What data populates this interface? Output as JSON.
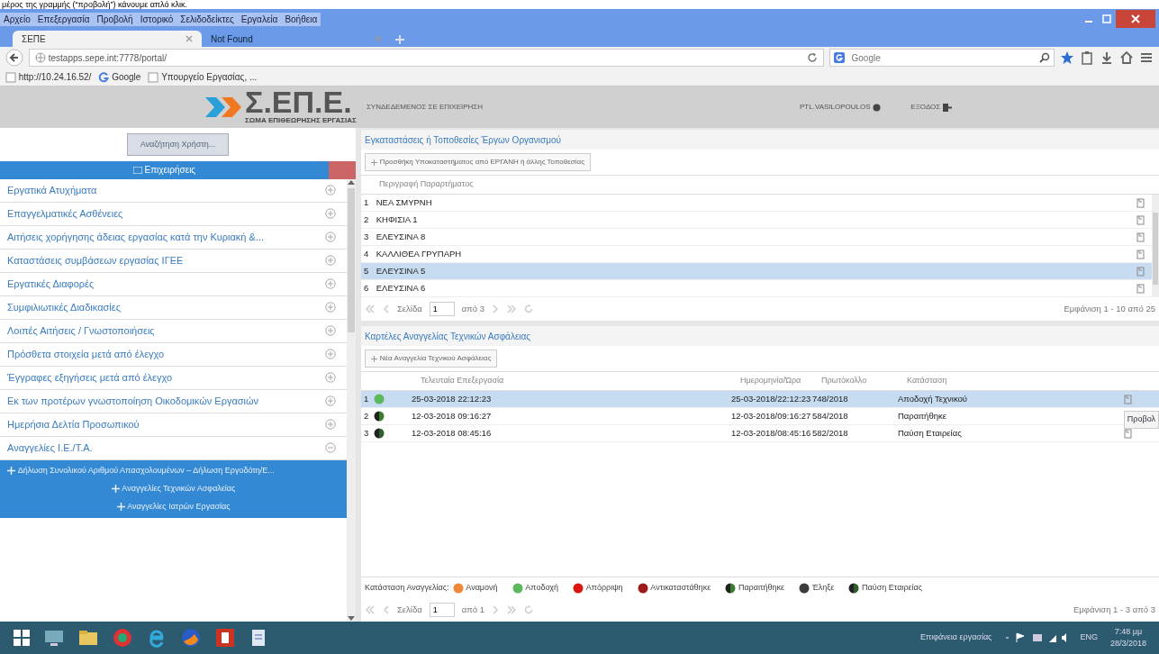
{
  "document_caption": "μέρος της γραμμής (“προβολή”) κάνουμε απλό κλικ.",
  "menu_bar": [
    "Αρχείο",
    "Επεξεργασία",
    "Προβολή",
    "Ιστορικό",
    "Σελιδοδείκτες",
    "Εργαλεία",
    "Βοήθεια"
  ],
  "browser_tabs": [
    {
      "label": "ΣΕΠΕ",
      "selected": true
    },
    {
      "label": "Not Found",
      "selected": false
    }
  ],
  "address_bar": {
    "value": "testapps.sepe.int:7778/portal/"
  },
  "search_bar": {
    "placeholder": "Google"
  },
  "bookmarks": [
    {
      "kind": "page",
      "label": "http://10.24.16.52/"
    },
    {
      "kind": "google",
      "label": "Google"
    },
    {
      "kind": "page",
      "label": "Υπουργείο Εργασίας, ..."
    }
  ],
  "app_header": {
    "logo": "Σ.ΕΠ.Ε.",
    "logo_subtitle": "ΣΩΜΑ ΕΠΙΘΕΩΡΗΣΗΣ ΕΡΓΑΣΙΑΣ",
    "context": "ΣΥΝΔΕΔΕΜΕΝΟΣ ΣΕ ΕΠΙΧΕΙΡΗΣΗ",
    "user": "PTL.VASILOPOULOS",
    "logout": "ΕΞΟΔΟΣ"
  },
  "sidebar": {
    "top_button": "Αναζήτηση Χρήστη...",
    "header": "Επιχειρήσεις",
    "items": [
      {
        "label": "Εργατικά Ατυχήματα",
        "expanded": false
      },
      {
        "label": "Επαγγελματικές Ασθένειες",
        "expanded": false
      },
      {
        "label": "Αιτήσεις χορήγησης άδειας εργασίας κατά την Κυριακή &...",
        "expanded": false
      },
      {
        "label": "Καταστάσεις συμβάσεων εργασίας ΙΓΕΕ",
        "expanded": false
      },
      {
        "label": "Εργατικές Διαφορές",
        "expanded": false
      },
      {
        "label": "Συμφιλιωτικές Διαδικασίες",
        "expanded": false
      },
      {
        "label": "Λοιπές Αιτήσεις / Γνωστοποιήσεις",
        "expanded": false
      },
      {
        "label": "Πρόσθετα στοιχεία μετά από έλεγχο",
        "expanded": false
      },
      {
        "label": "Έγγραφες εξηγήσεις μετά από έλεγχο",
        "expanded": false
      },
      {
        "label": "Εκ των προτέρων γνωστοποίηση Οικοδομικών Εργασιών",
        "expanded": false
      },
      {
        "label": "Ημερήσια Δελτία Προσωπικού",
        "expanded": false
      },
      {
        "label": "Αναγγελίες Ι.Ε./Τ.Α.",
        "expanded": true,
        "children": [
          {
            "label": "Δήλωση Συνολικού Αριθμού Απασχολουμένων – Δήλωση Εργοδότη/Ε..."
          },
          {
            "label": "Αναγγελίες Τεχνικών Ασφαλείας"
          },
          {
            "label": "Αναγγελίες Ιατρών Εργασίας"
          }
        ]
      }
    ]
  },
  "branches_panel": {
    "title": "Εγκαταστάσεις ή Τοποθεσίες Έργων Οργανισμού",
    "add_button": "Προσθήκη Υποκαταστήματος από ΕΡΓΑΝΗ ή άλλης Τοποθεσίας",
    "column": "Περιγραφή Παραρτήματος",
    "rows": [
      {
        "number": "1",
        "name": "ΝΕΑ ΣΜΥΡΝΗ",
        "selected": false
      },
      {
        "number": "2",
        "name": "ΚΗΦΙΣΙΑ 1",
        "selected": false
      },
      {
        "number": "3",
        "name": "ΕΛΕΥΣΙΝΑ 8",
        "selected": false
      },
      {
        "number": "4",
        "name": "ΚΑΛΛΙΘΕΑ ΓΡΥΠΑΡΗ",
        "selected": false
      },
      {
        "number": "5",
        "name": "ΕΛΕΥΣΙΝΑ 5",
        "selected": true
      },
      {
        "number": "6",
        "name": "ΕΛΕΥΣΙΝΑ 6",
        "selected": false
      }
    ],
    "pager": {
      "page_label": "Σελίδα",
      "page": "1",
      "of": "από 3",
      "summary": "Εμφάνιση 1 - 10 από 25"
    }
  },
  "announcements_panel": {
    "title": "Καρτέλες Αναγγελίας Τεχνικών Ασφάλειας",
    "add_button": "Νέα Αναγγελία Τεχνικού Ασφάλειας",
    "columns": [
      "Τελευταία Επεξεργασία",
      "Ημερομηνία/Ώρα",
      "Πρωτόκολλο",
      "Κατάσταση"
    ],
    "rows": [
      {
        "number": "1",
        "kind": "full",
        "color": "#5cb85c",
        "edited": "25-03-2018 22:12:23",
        "datetime": "25-03-2018/22:12:23",
        "protocol": "748/2018",
        "status": "Αποδοχή Τεχνικού",
        "selected": true
      },
      {
        "number": "2",
        "kind": "half",
        "color": "#3a7d2c",
        "edited": "12-03-2018 09:16:27",
        "datetime": "12-03-2018/09:16:27",
        "protocol": "584/2018",
        "status": "Παραιτήθηκε",
        "selected": false
      },
      {
        "number": "3",
        "kind": "half",
        "color": "#2e5e2a",
        "edited": "12-03-2018 08:45:16",
        "datetime": "12-03-2018/08:45:16",
        "protocol": "582/2018",
        "status": "Παύση Εταιρείας",
        "selected": false
      }
    ],
    "tooltip": "Προβολ",
    "legend_label": "Κατάσταση Αναγγελίας:",
    "legend": [
      {
        "kind": "full",
        "color": "#f0883a",
        "label": "Αναμονή"
      },
      {
        "kind": "full",
        "color": "#5cb85c",
        "label": "Αποδοχή"
      },
      {
        "kind": "full",
        "color": "#d9160f",
        "label": "Απόρριψη"
      },
      {
        "kind": "full",
        "color": "#9c1b1b",
        "label": "Αντικαταστάθηκε"
      },
      {
        "kind": "half",
        "color": "#3a7d2c",
        "label": "Παραιτήθηκε"
      },
      {
        "kind": "full",
        "color": "#3c3c3c",
        "label": "Έληξε"
      },
      {
        "kind": "half",
        "color": "#2e5e2a",
        "label": "Παύση Εταιρείας"
      }
    ],
    "pager": {
      "page_label": "Σελίδα",
      "page": "1",
      "of": "από 1",
      "summary": "Εμφάνιση 1 - 3 από 3"
    }
  },
  "taskbar": {
    "desktop_label": "Επιφάνεια εργασίας",
    "language": "ENG",
    "time": "7:48 μμ",
    "date": "28/3/2018"
  }
}
